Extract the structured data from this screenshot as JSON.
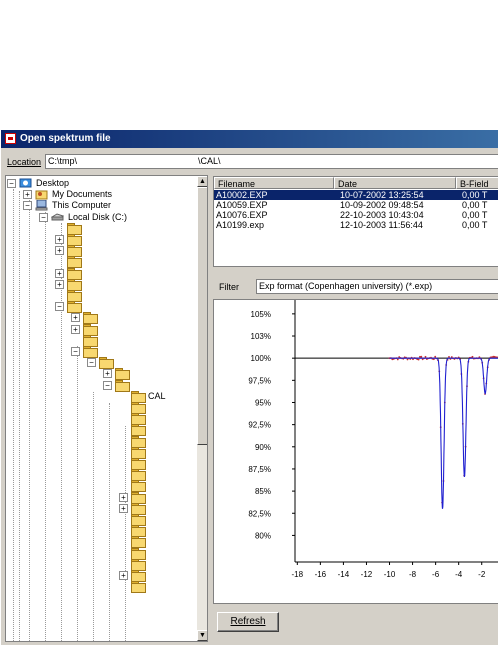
{
  "window": {
    "title": "Open spektrum file"
  },
  "location": {
    "label": "Location",
    "value": "C:\\tmp\\",
    "subpath": "\\CAL\\"
  },
  "tree": {
    "desktop": "Desktop",
    "my_documents": "My Documents",
    "this_computer": "This Computer",
    "local_disk": "Local Disk (C:)",
    "cal": "CAL"
  },
  "file_list": {
    "columns": [
      "Filename",
      "Date",
      "B-Field"
    ],
    "rows": [
      [
        "A10002.EXP",
        "10-07-2002 13:25:54",
        "0,00 T"
      ],
      [
        "A10059.EXP",
        "10-09-2002 09:48:54",
        "0,00 T"
      ],
      [
        "A10076.EXP",
        "22-10-2003 10:43:04",
        "0,00 T"
      ],
      [
        "A10199.exp",
        "12-10-2003 11:56:44",
        "0,00 T"
      ]
    ],
    "selected_index": 0
  },
  "filter": {
    "label": "Filter",
    "value": "Exp format (Copenhagen university) (*.exp)"
  },
  "refresh_label": "Refresh",
  "colors": {
    "fit_line": "#2020d0",
    "data_points": "#c83030",
    "selection": "#0a246a",
    "title_bar": "#0a246a"
  },
  "chart_data": {
    "type": "line",
    "y_tick_labels": [
      "105%",
      "103%",
      "100%",
      "97,5%",
      "95%",
      "92,5%",
      "90%",
      "87,5%",
      "85%",
      "82,5%",
      "80%"
    ],
    "y_ticks": [
      105,
      102.5,
      100,
      97.5,
      95,
      92.5,
      90,
      87.5,
      85,
      82.5,
      80
    ],
    "x_ticks": [
      -18,
      -16,
      -14,
      -12,
      -10,
      -8,
      -6,
      -4,
      -2
    ],
    "xlim": [
      -18.2,
      0.8
    ],
    "ylim": [
      77,
      106
    ],
    "baseline": 100,
    "data_x_range": [
      -10,
      0.8
    ],
    "dips": [
      {
        "center": -5.4,
        "min": 83.0
      },
      {
        "center": -3.5,
        "min": 86.6
      },
      {
        "center": -1.7,
        "min": 96.0
      }
    ],
    "series": [
      {
        "values": "fit",
        "color": "#2020d0"
      },
      {
        "values": "measurements",
        "color": "#c83030"
      }
    ]
  }
}
